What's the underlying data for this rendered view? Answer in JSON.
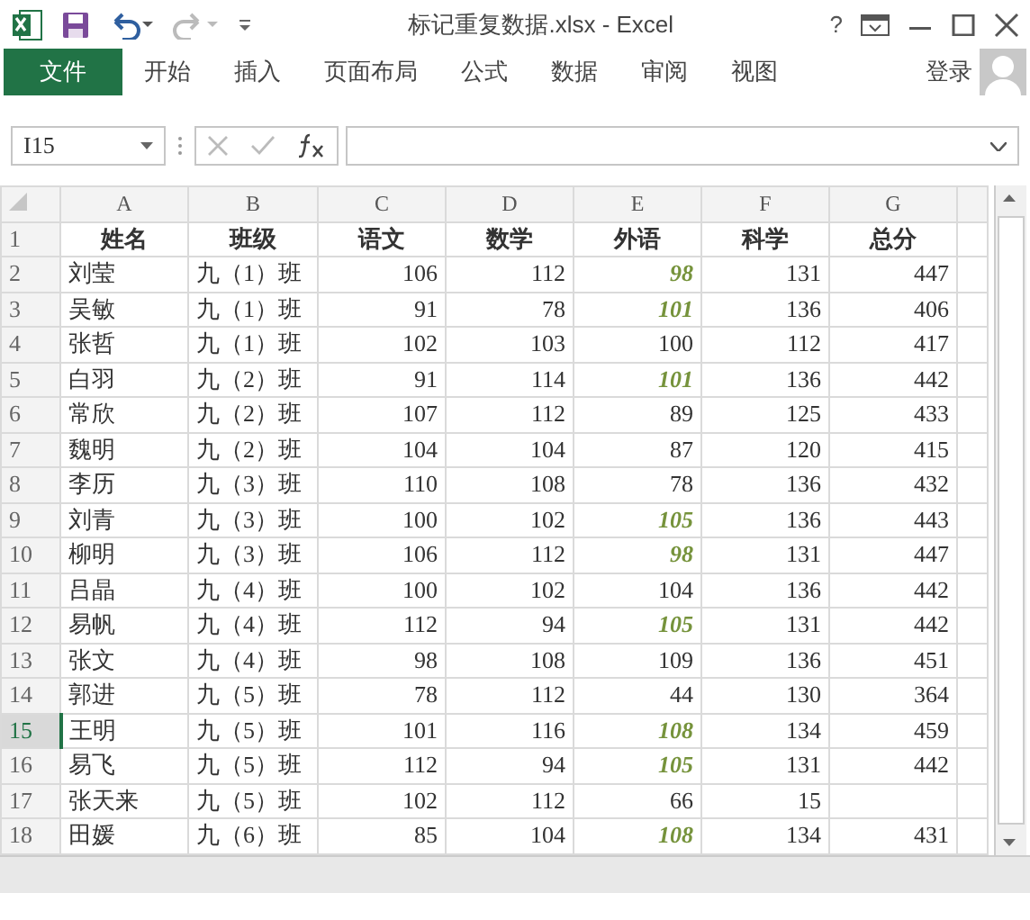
{
  "window": {
    "title": "标记重复数据.xlsx - Excel",
    "help": "?"
  },
  "ribbon": {
    "file_tab": "文件",
    "tabs": [
      {
        "label": "开始",
        "selected": false
      },
      {
        "label": "插入",
        "selected": false
      },
      {
        "label": "页面布局",
        "selected": false
      },
      {
        "label": "公式",
        "selected": false
      },
      {
        "label": "数据",
        "selected": false
      },
      {
        "label": "审阅",
        "selected": false
      },
      {
        "label": "视图",
        "selected": false
      }
    ],
    "sign_in": "登录"
  },
  "formula_bar": {
    "name_box": "I15"
  },
  "sheet": {
    "columns": [
      "A",
      "B",
      "C",
      "D",
      "E",
      "F",
      "G"
    ],
    "rows": [
      {
        "number": "1",
        "selected": false,
        "header": true,
        "cells": [
          "姓名",
          "班级",
          "语文",
          "数学",
          "外语",
          "科学",
          "总分"
        ]
      },
      {
        "number": "2",
        "selected": false,
        "header": false,
        "highlight": true,
        "cells": [
          "刘莹",
          "九（1）班",
          "106",
          "112",
          "98",
          "131",
          "447"
        ]
      },
      {
        "number": "3",
        "selected": false,
        "header": false,
        "highlight": true,
        "cells": [
          "吴敏",
          "九（1）班",
          "91",
          "78",
          "101",
          "136",
          "406"
        ]
      },
      {
        "number": "4",
        "selected": false,
        "header": false,
        "highlight": false,
        "cells": [
          "张哲",
          "九（1）班",
          "102",
          "103",
          "100",
          "112",
          "417"
        ]
      },
      {
        "number": "5",
        "selected": false,
        "header": false,
        "highlight": true,
        "cells": [
          "白羽",
          "九（2）班",
          "91",
          "114",
          "101",
          "136",
          "442"
        ]
      },
      {
        "number": "6",
        "selected": false,
        "header": false,
        "highlight": false,
        "cells": [
          "常欣",
          "九（2）班",
          "107",
          "112",
          "89",
          "125",
          "433"
        ]
      },
      {
        "number": "7",
        "selected": false,
        "header": false,
        "highlight": false,
        "cells": [
          "魏明",
          "九（2）班",
          "104",
          "104",
          "87",
          "120",
          "415"
        ]
      },
      {
        "number": "8",
        "selected": false,
        "header": false,
        "highlight": false,
        "cells": [
          "李历",
          "九（3）班",
          "110",
          "108",
          "78",
          "136",
          "432"
        ]
      },
      {
        "number": "9",
        "selected": false,
        "header": false,
        "highlight": true,
        "cells": [
          "刘青",
          "九（3）班",
          "100",
          "102",
          "105",
          "136",
          "443"
        ]
      },
      {
        "number": "10",
        "selected": false,
        "header": false,
        "highlight": true,
        "cells": [
          "柳明",
          "九（3）班",
          "106",
          "112",
          "98",
          "131",
          "447"
        ]
      },
      {
        "number": "11",
        "selected": false,
        "header": false,
        "highlight": false,
        "cells": [
          "吕晶",
          "九（4）班",
          "100",
          "102",
          "104",
          "136",
          "442"
        ]
      },
      {
        "number": "12",
        "selected": false,
        "header": false,
        "highlight": true,
        "cells": [
          "易帆",
          "九（4）班",
          "112",
          "94",
          "105",
          "131",
          "442"
        ]
      },
      {
        "number": "13",
        "selected": false,
        "header": false,
        "highlight": false,
        "cells": [
          "张文",
          "九（4）班",
          "98",
          "108",
          "109",
          "136",
          "451"
        ]
      },
      {
        "number": "14",
        "selected": false,
        "header": false,
        "highlight": false,
        "cells": [
          "郭进",
          "九（5）班",
          "78",
          "112",
          "44",
          "130",
          "364"
        ]
      },
      {
        "number": "15",
        "selected": true,
        "header": false,
        "highlight": true,
        "cells": [
          "王明",
          "九（5）班",
          "101",
          "116",
          "108",
          "134",
          "459"
        ]
      },
      {
        "number": "16",
        "selected": false,
        "header": false,
        "highlight": true,
        "cells": [
          "易飞",
          "九（5）班",
          "112",
          "94",
          "105",
          "131",
          "442"
        ]
      },
      {
        "number": "17",
        "selected": false,
        "header": false,
        "highlight": false,
        "cells": [
          "张天来",
          "九（5）班",
          "102",
          "112",
          "66",
          "15"
        ]
      },
      {
        "number": "18",
        "selected": false,
        "header": false,
        "highlight": true,
        "cells": [
          "田媛",
          "九（6）班",
          "85",
          "104",
          "108",
          "134",
          "431"
        ]
      }
    ]
  }
}
